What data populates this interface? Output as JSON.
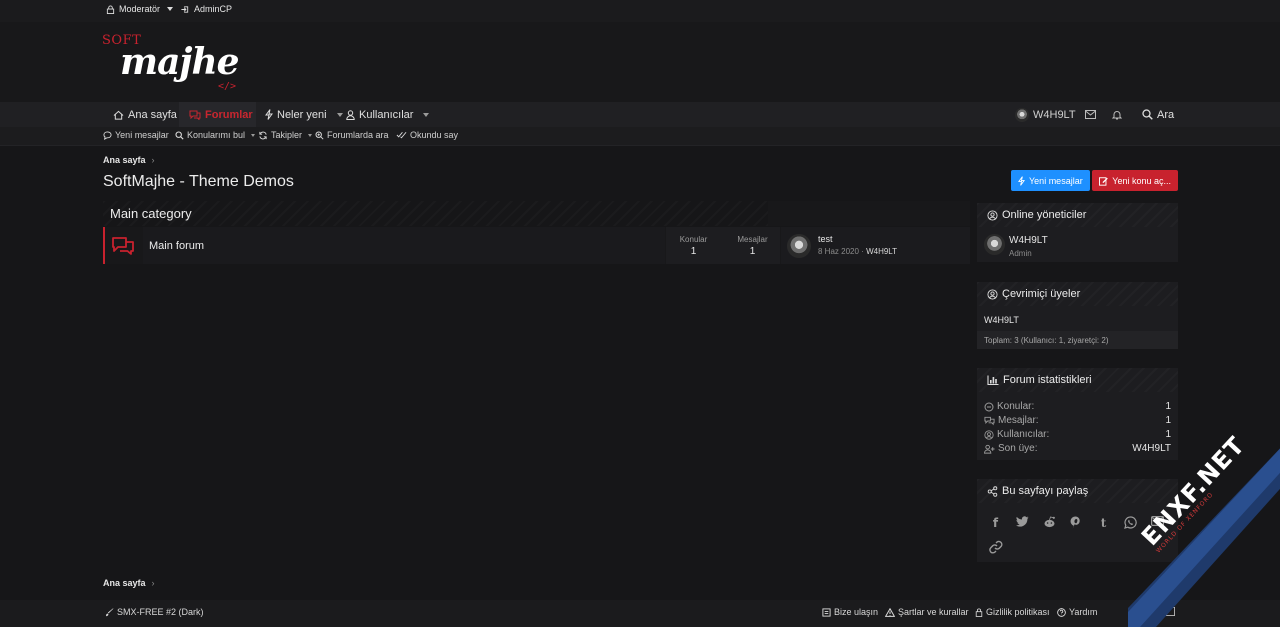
{
  "staff": {
    "moderator": "Moderatör",
    "admincp": "AdminCP"
  },
  "logo": {
    "soft": "SOFT",
    "majhe": "majhe",
    "code": "</>"
  },
  "nav": {
    "home": "Ana sayfa",
    "forums": "Forumlar",
    "whats_new": "Neler yeni",
    "members": "Kullanıcılar",
    "username": "W4H9LT",
    "search": "Ara"
  },
  "subnav": {
    "new_posts": "Yeni mesajlar",
    "find_threads": "Konularımı bul",
    "watched": "Takipler",
    "search_forums": "Forumlarda ara",
    "mark_read": "Okundu say"
  },
  "breadcrumb": {
    "home": "Ana sayfa"
  },
  "page": {
    "title": "SoftMajhe - Theme Demos",
    "new_posts_button": "Yeni mesajlar",
    "new_thread_button": "Yeni konu aç..."
  },
  "category": {
    "title": "Main category",
    "forum": {
      "name": "Main forum",
      "threads_label": "Konular",
      "threads": "1",
      "messages_label": "Mesajlar",
      "messages": "1",
      "last_title": "test",
      "last_date": "8 Haz 2020",
      "last_user": "W4H9LT"
    }
  },
  "sidebar": {
    "staff_online": {
      "title": "Online yöneticiler",
      "user": "W4H9LT",
      "role": "Admin"
    },
    "members_online": {
      "title": "Çevrimiçi üyeler",
      "user": "W4H9LT",
      "total": "Toplam: 3 (Kullanıcı: 1, ziyaretçi: 2)"
    },
    "stats": {
      "title": "Forum istatistikleri",
      "threads_label": "Konular:",
      "threads": "1",
      "messages_label": "Mesajlar:",
      "messages": "1",
      "members_label": "Kullanıcılar:",
      "members": "1",
      "latest_label": "Son üye:",
      "latest": "W4H9LT"
    },
    "share": {
      "title": "Bu sayfayı paylaş"
    }
  },
  "footer": {
    "style": "SMX-FREE #2 (Dark)",
    "contact": "Bize ulaşın",
    "terms": "Şartlar ve kurallar",
    "privacy": "Gizlilik politikası",
    "help": "Yardım"
  },
  "watermark": {
    "brand": "ENXF.NET",
    "tagline": "WORLD OF XENFORO"
  },
  "colors": {
    "accent": "#c8222e",
    "blue": "#1e90ff",
    "background": "#161618"
  }
}
